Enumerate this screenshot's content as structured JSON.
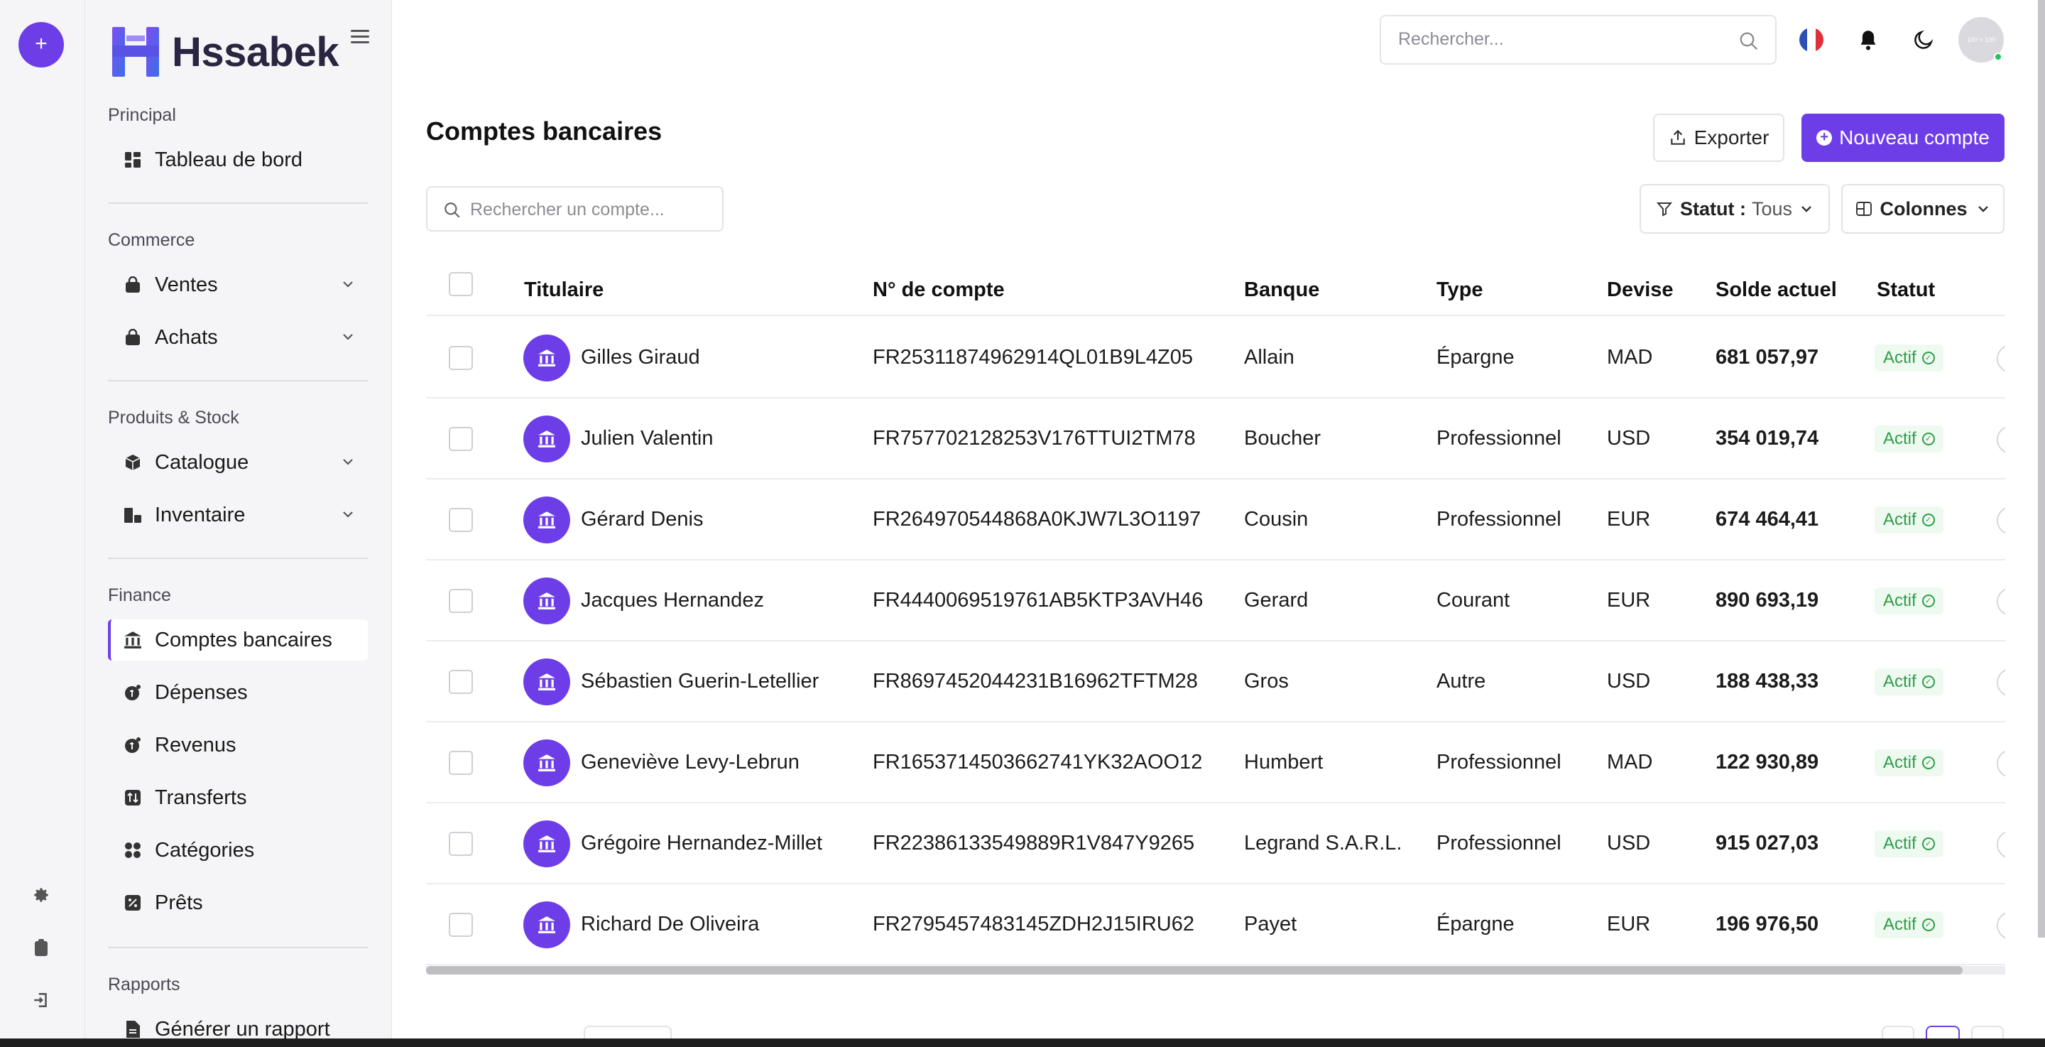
{
  "rail": {
    "add_label": "+",
    "icons": [
      "gear-icon",
      "clipboard-icon",
      "logout-icon"
    ]
  },
  "brand": {
    "name": "Hssabek"
  },
  "sidebar": {
    "sections": [
      {
        "title": "Principal",
        "items": [
          {
            "label": "Tableau de bord",
            "icon": "dashboard-icon"
          }
        ]
      },
      {
        "title": "Commerce",
        "items": [
          {
            "label": "Ventes",
            "icon": "bag-icon",
            "expandable": true
          },
          {
            "label": "Achats",
            "icon": "bag-icon",
            "expandable": true
          }
        ]
      },
      {
        "title": "Produits & Stock",
        "items": [
          {
            "label": "Catalogue",
            "icon": "box-icon",
            "expandable": true
          },
          {
            "label": "Inventaire",
            "icon": "warehouse-icon",
            "expandable": true
          }
        ]
      },
      {
        "title": "Finance",
        "items": [
          {
            "label": "Comptes bancaires",
            "icon": "bank-icon",
            "active": true
          },
          {
            "label": "Dépenses",
            "icon": "coin-icon"
          },
          {
            "label": "Revenus",
            "icon": "coin-icon"
          },
          {
            "label": "Transferts",
            "icon": "transfer-icon"
          },
          {
            "label": "Catégories",
            "icon": "grid-icon"
          },
          {
            "label": "Prêts",
            "icon": "percent-icon"
          }
        ]
      },
      {
        "title": "Rapports",
        "items": [
          {
            "label": "Générer un rapport",
            "icon": "report-icon"
          }
        ]
      }
    ]
  },
  "header": {
    "search_placeholder": "Rechercher...",
    "avatar_text": "100 × 100"
  },
  "page": {
    "title": "Comptes bancaires",
    "export_label": "Exporter",
    "new_label": "Nouveau compte",
    "search_placeholder": "Rechercher un compte...",
    "status_filter_label": "Statut :",
    "status_filter_value": "Tous",
    "columns_label": "Colonnes"
  },
  "table": {
    "headers": [
      "Titulaire",
      "N° de compte",
      "Banque",
      "Type",
      "Devise",
      "Solde actuel",
      "Statut"
    ],
    "rows": [
      {
        "holder": "Gilles Giraud",
        "account": "FR25311874962914QL01B9L4Z05",
        "bank": "Allain",
        "type": "Épargne",
        "currency": "MAD",
        "balance": "681 057,97",
        "status": "Actif"
      },
      {
        "holder": "Julien Valentin",
        "account": "FR757702128253V176TTUI2TM78",
        "bank": "Boucher",
        "type": "Professionnel",
        "currency": "USD",
        "balance": "354 019,74",
        "status": "Actif"
      },
      {
        "holder": "Gérard Denis",
        "account": "FR264970544868A0KJW7L3O1197",
        "bank": "Cousin",
        "type": "Professionnel",
        "currency": "EUR",
        "balance": "674 464,41",
        "status": "Actif"
      },
      {
        "holder": "Jacques Hernandez",
        "account": "FR4440069519761AB5KTP3AVH46",
        "bank": "Gerard",
        "type": "Courant",
        "currency": "EUR",
        "balance": "890 693,19",
        "status": "Actif"
      },
      {
        "holder": "Sébastien Guerin-Letellier",
        "account": "FR8697452044231B16962TFTM28",
        "bank": "Gros",
        "type": "Autre",
        "currency": "USD",
        "balance": "188 438,33",
        "status": "Actif"
      },
      {
        "holder": "Geneviève Levy-Lebrun",
        "account": "FR1653714503662741YK32AOO12",
        "bank": "Humbert",
        "type": "Professionnel",
        "currency": "MAD",
        "balance": "122 930,89",
        "status": "Actif"
      },
      {
        "holder": "Grégoire Hernandez-Millet",
        "account": "FR22386133549889R1V847Y9265",
        "bank": "Legrand S.A.R.L.",
        "type": "Professionnel",
        "currency": "USD",
        "balance": "915 027,03",
        "status": "Actif"
      },
      {
        "holder": "Richard De Oliveira",
        "account": "FR2795457483145ZDH2J15IRU62",
        "bank": "Payet",
        "type": "Épargne",
        "currency": "EUR",
        "balance": "196 976,50",
        "status": "Actif"
      }
    ]
  },
  "colors": {
    "accent": "#6d3ee8",
    "success": "#2e9d4a"
  }
}
